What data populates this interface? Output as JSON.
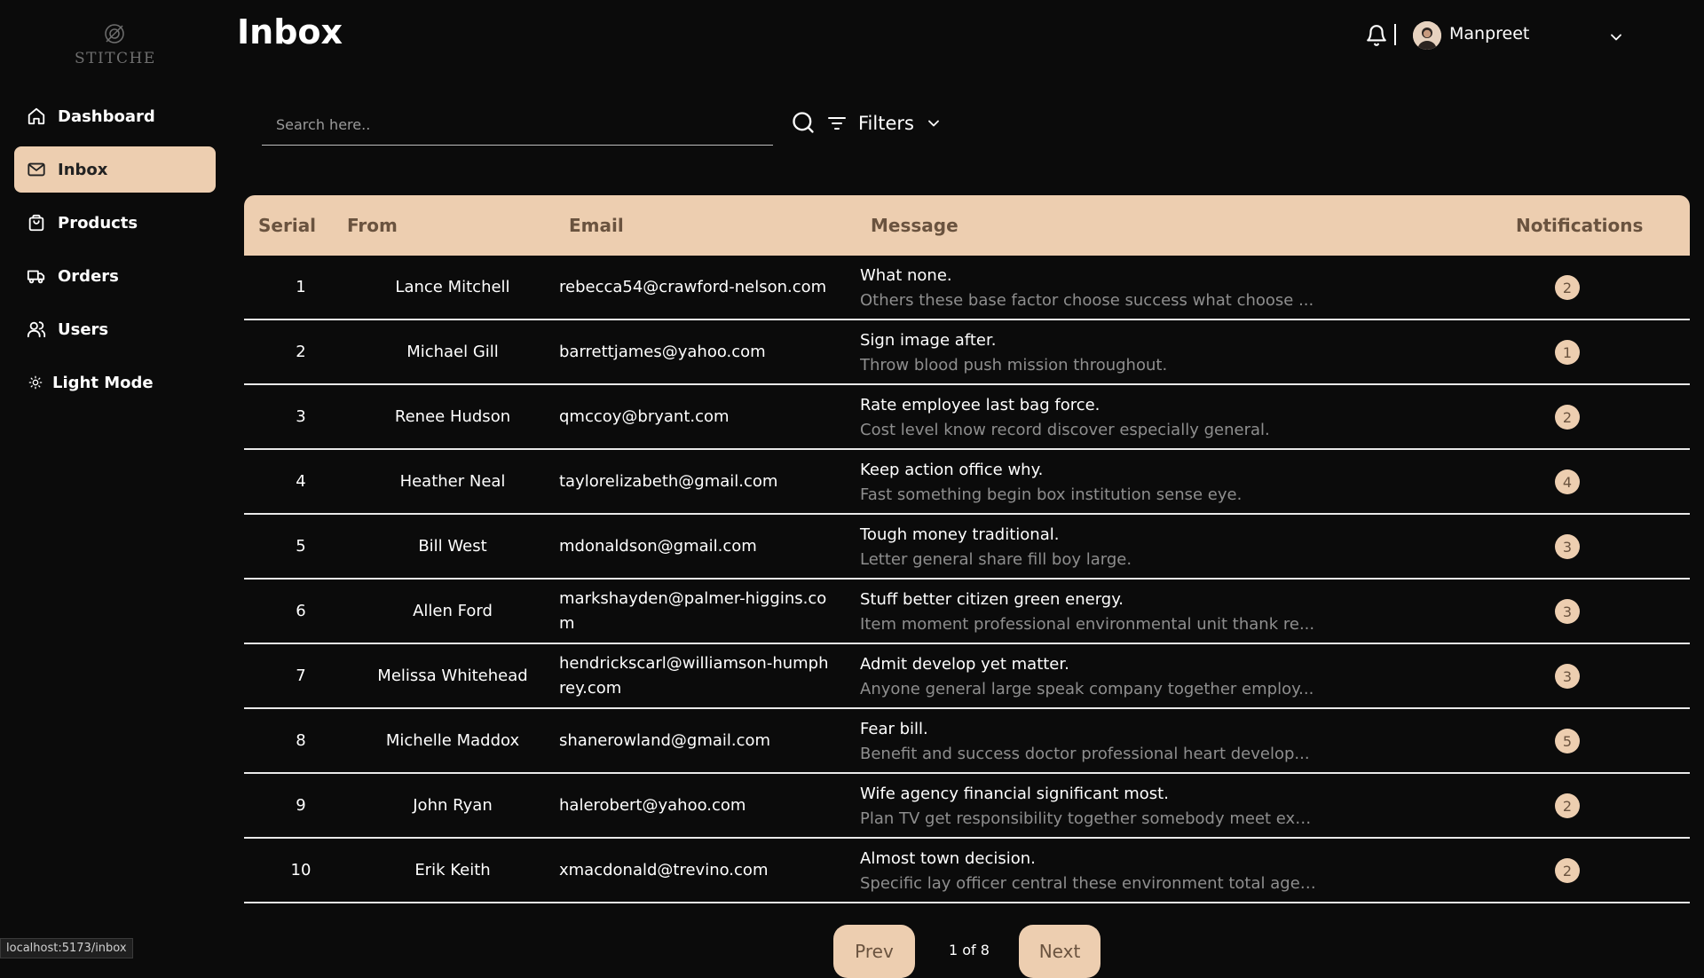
{
  "brand": {
    "logo_text": "STITCHE"
  },
  "sidebar": {
    "items": [
      {
        "label": "Dashboard",
        "icon": "home-icon"
      },
      {
        "label": "Inbox",
        "icon": "mail-icon",
        "active": true
      },
      {
        "label": "Products",
        "icon": "shopping-bag-icon"
      },
      {
        "label": "Orders",
        "icon": "truck-icon"
      },
      {
        "label": "Users",
        "icon": "users-icon"
      },
      {
        "label": "Light Mode",
        "icon": "sun-icon"
      }
    ]
  },
  "header": {
    "title": "Inbox",
    "user_name": "Manpreet"
  },
  "search": {
    "placeholder": "Search here.."
  },
  "filters": {
    "label": "Filters"
  },
  "table": {
    "columns": [
      "Serial",
      "From",
      "Email",
      "Message",
      "Notifications"
    ],
    "rows": [
      {
        "serial": "1",
        "from": "Lance Mitchell",
        "email": "rebecca54@crawford-nelson.com",
        "subject": "What none.",
        "body": "Others these base factor choose success what choose ...",
        "notifications": "2"
      },
      {
        "serial": "2",
        "from": "Michael Gill",
        "email": "barrettjames@yahoo.com",
        "subject": "Sign image after.",
        "body": "Throw blood push mission throughout.",
        "notifications": "1"
      },
      {
        "serial": "3",
        "from": "Renee Hudson",
        "email": "qmccoy@bryant.com",
        "subject": "Rate employee last bag force.",
        "body": "Cost level know record discover especially general.",
        "notifications": "2"
      },
      {
        "serial": "4",
        "from": "Heather Neal",
        "email": "taylorelizabeth@gmail.com",
        "subject": "Keep action office why.",
        "body": "Fast something begin box institution sense eye.",
        "notifications": "4"
      },
      {
        "serial": "5",
        "from": "Bill West",
        "email": "mdonaldson@gmail.com",
        "subject": "Tough money traditional.",
        "body": "Letter general share fill boy large.",
        "notifications": "3"
      },
      {
        "serial": "6",
        "from": "Allen Ford",
        "email": "markshayden@palmer-higgins.com",
        "subject": "Stuff better citizen green energy.",
        "body": "Item moment professional environmental unit thank re...",
        "notifications": "3"
      },
      {
        "serial": "7",
        "from": "Melissa Whitehead",
        "email": "hendrickscarl@williamson-humphrey.com",
        "subject": "Admit develop yet matter.",
        "body": "Anyone general large speak company together employ...",
        "notifications": "3"
      },
      {
        "serial": "8",
        "from": "Michelle Maddox",
        "email": "shanerowland@gmail.com",
        "subject": "Fear bill.",
        "body": "Benefit and success doctor professional heart develop...",
        "notifications": "5"
      },
      {
        "serial": "9",
        "from": "John Ryan",
        "email": "halerobert@yahoo.com",
        "subject": "Wife agency financial significant most.",
        "body": "Plan TV get responsibility together somebody meet exa...",
        "notifications": "2"
      },
      {
        "serial": "10",
        "from": "Erik Keith",
        "email": "xmacdonald@trevino.com",
        "subject": "Almost town decision.",
        "body": "Specific lay officer central these environment total age ...",
        "notifications": "2"
      }
    ]
  },
  "pagination": {
    "prev_label": "Prev",
    "info": "1 of 8",
    "next_label": "Next"
  },
  "status_bar": {
    "url": "localhost:5173/inbox"
  },
  "colors": {
    "accent": "#edceb0",
    "background": "#0b0b0b",
    "accent_text": "#6a533f"
  }
}
